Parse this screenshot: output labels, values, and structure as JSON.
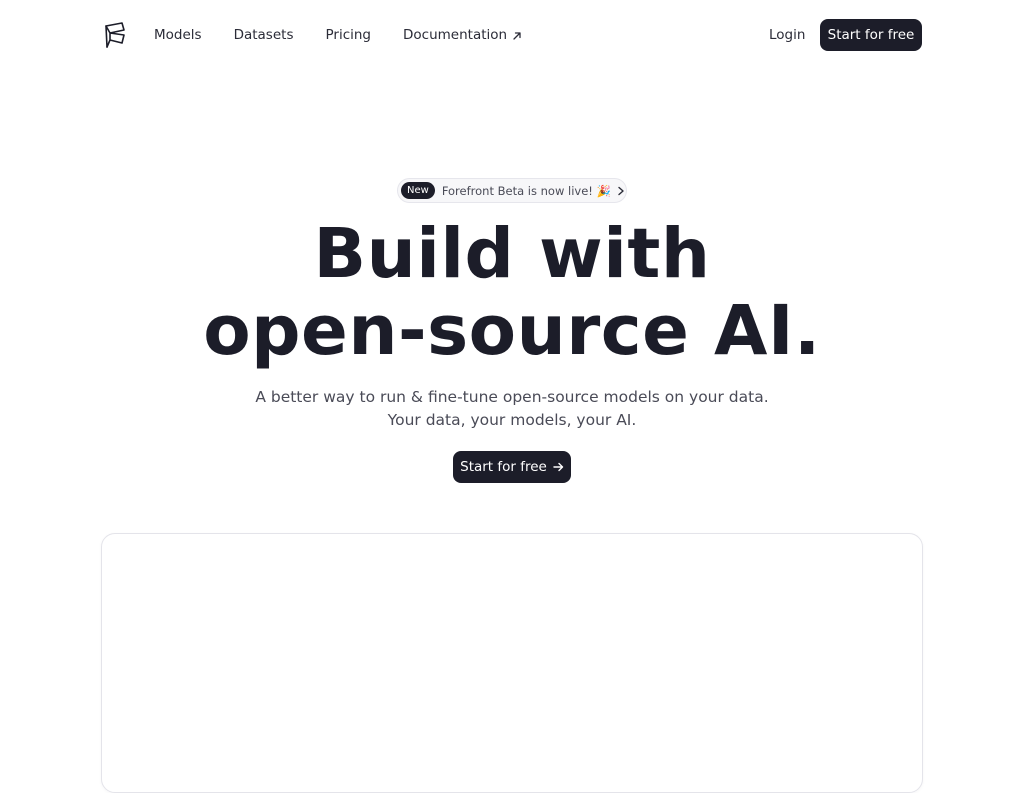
{
  "nav": {
    "links": [
      "Models",
      "Datasets",
      "Pricing",
      "Documentation"
    ],
    "external_link_icon": "arrow-up-right-icon",
    "login_label": "Login",
    "cta_label": "Start for free"
  },
  "logo": {
    "icon": "forefront-logo-icon"
  },
  "announcement": {
    "badge": "New",
    "text": "Forefront Beta is now live! 🎉",
    "icon": "chevron-right-icon"
  },
  "hero": {
    "title_lines": [
      "Build with",
      "open-source AI."
    ],
    "subtitle_lines": [
      "A better way to run & fine-tune open-source models on your data.",
      "Your data, your models, your AI."
    ],
    "cta_label": "Start for free",
    "cta_icon": "arrow-right-icon"
  },
  "colors": {
    "primary": "#1c1d29",
    "text_muted": "#4a4b57",
    "border": "#e4e4ea",
    "background": "#ffffff"
  }
}
